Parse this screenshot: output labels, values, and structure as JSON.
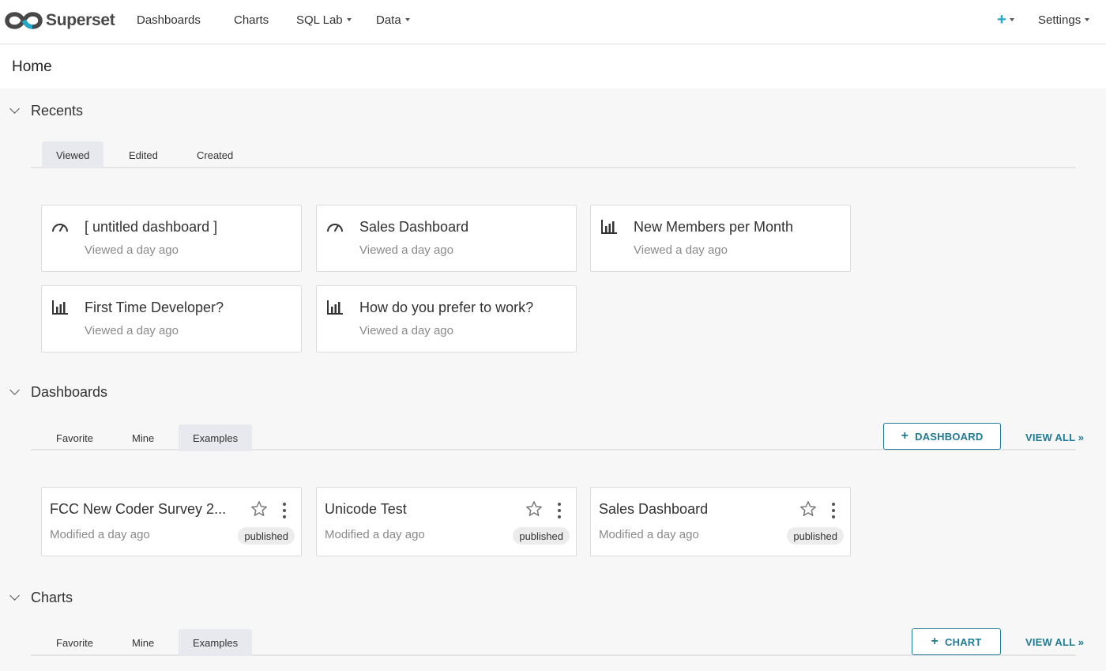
{
  "nav": {
    "brand": "Superset",
    "items": [
      "Dashboards",
      "Charts",
      "SQL Lab",
      "Data"
    ],
    "plus": "+",
    "settings": "Settings"
  },
  "page": {
    "title": "Home"
  },
  "recents": {
    "title": "Recents",
    "tabs": [
      "Viewed",
      "Edited",
      "Created"
    ],
    "active_tab": "Viewed",
    "cards": [
      {
        "icon": "dashboard-gauge-icon",
        "title": "[ untitled dashboard ]",
        "subtitle": "Viewed a day ago"
      },
      {
        "icon": "dashboard-gauge-icon",
        "title": "Sales Dashboard",
        "subtitle": "Viewed a day ago"
      },
      {
        "icon": "bar-chart-icon",
        "title": "New Members per Month",
        "subtitle": "Viewed a day ago"
      },
      {
        "icon": "bar-chart-icon",
        "title": "First Time Developer?",
        "subtitle": "Viewed a day ago"
      },
      {
        "icon": "bar-chart-icon",
        "title": "How do you prefer to work?",
        "subtitle": "Viewed a day ago"
      }
    ]
  },
  "dashboards": {
    "title": "Dashboards",
    "tabs": [
      "Favorite",
      "Mine",
      "Examples"
    ],
    "active_tab": "Examples",
    "add_button": "DASHBOARD",
    "view_all": "VIEW ALL »",
    "cards": [
      {
        "title": "FCC New Coder Survey 2...",
        "subtitle": "Modified a day ago",
        "status": "published"
      },
      {
        "title": "Unicode Test",
        "subtitle": "Modified a day ago",
        "status": "published"
      },
      {
        "title": "Sales Dashboard",
        "subtitle": "Modified a day ago",
        "status": "published"
      }
    ]
  },
  "charts": {
    "title": "Charts",
    "tabs": [
      "Favorite",
      "Mine",
      "Examples"
    ],
    "active_tab": "Examples",
    "add_button": "CHART",
    "view_all": "VIEW ALL »"
  },
  "colors": {
    "accent": "#1f7a93",
    "brand_blue": "#20a7c9",
    "brand_gray": "#484848"
  }
}
